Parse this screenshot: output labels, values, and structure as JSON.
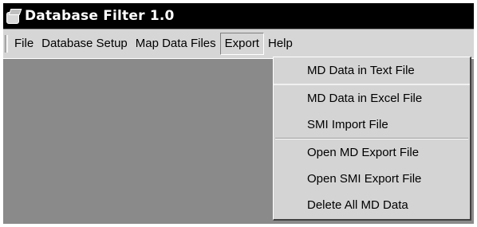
{
  "window": {
    "title": "Database Filter 1.0"
  },
  "menubar": {
    "items": [
      {
        "label": "File"
      },
      {
        "label": "Database Setup"
      },
      {
        "label": "Map Data Files"
      },
      {
        "label": "Export"
      },
      {
        "label": "Help"
      }
    ]
  },
  "export_menu": {
    "items": [
      {
        "label": "MD Data in Text File"
      },
      {
        "label": "MD Data in  Excel File"
      },
      {
        "label": "SMI Import File"
      },
      {
        "label": "Open MD Export File"
      },
      {
        "label": "Open SMI Export File"
      },
      {
        "label": "Delete All MD Data"
      }
    ]
  },
  "colors": {
    "titlebar": "#000000",
    "menubar": "#d6d6d6",
    "workspace": "#8a8a8a"
  }
}
